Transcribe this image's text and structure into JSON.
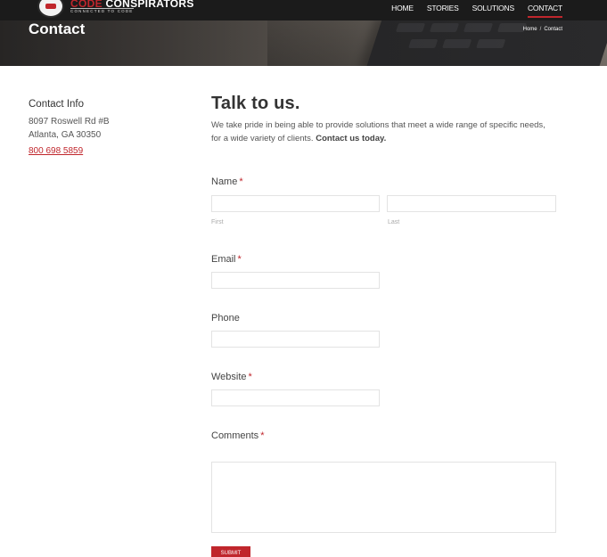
{
  "brand": {
    "name_red": "CODE",
    "name_white": " CONSPIRATORS",
    "tagline": "CONNECTED TO CODE"
  },
  "nav": {
    "items": [
      {
        "label": "HOME",
        "active": false
      },
      {
        "label": "STORIES",
        "active": false
      },
      {
        "label": "SOLUTIONS",
        "active": false
      },
      {
        "label": "CONTACT",
        "active": true
      }
    ]
  },
  "hero": {
    "title": "Contact",
    "breadcrumb": {
      "home": "Home",
      "separator": "/",
      "current": "Contact"
    }
  },
  "contact_info": {
    "heading": "Contact Info",
    "address_line1": "8097 Roswell Rd #B",
    "address_line2": "Atlanta, GA 30350",
    "phone": "800 698 5859"
  },
  "form": {
    "heading": "Talk to us.",
    "intro": "We take pride in being able to provide solutions that meet a wide range of specific needs, for a wide variety of clients. ",
    "intro_bold": "Contact us today.",
    "required_mark": "*",
    "name": {
      "label": "Name",
      "first_label": "First",
      "last_label": "Last",
      "first_value": "",
      "last_value": ""
    },
    "email": {
      "label": "Email",
      "value": ""
    },
    "phone": {
      "label": "Phone",
      "value": ""
    },
    "website": {
      "label": "Website",
      "value": ""
    },
    "comments": {
      "label": "Comments",
      "value": ""
    },
    "submit_label": "SUBMIT"
  },
  "colors": {
    "accent": "#c0262c",
    "navbar": "#1b1b1b"
  }
}
